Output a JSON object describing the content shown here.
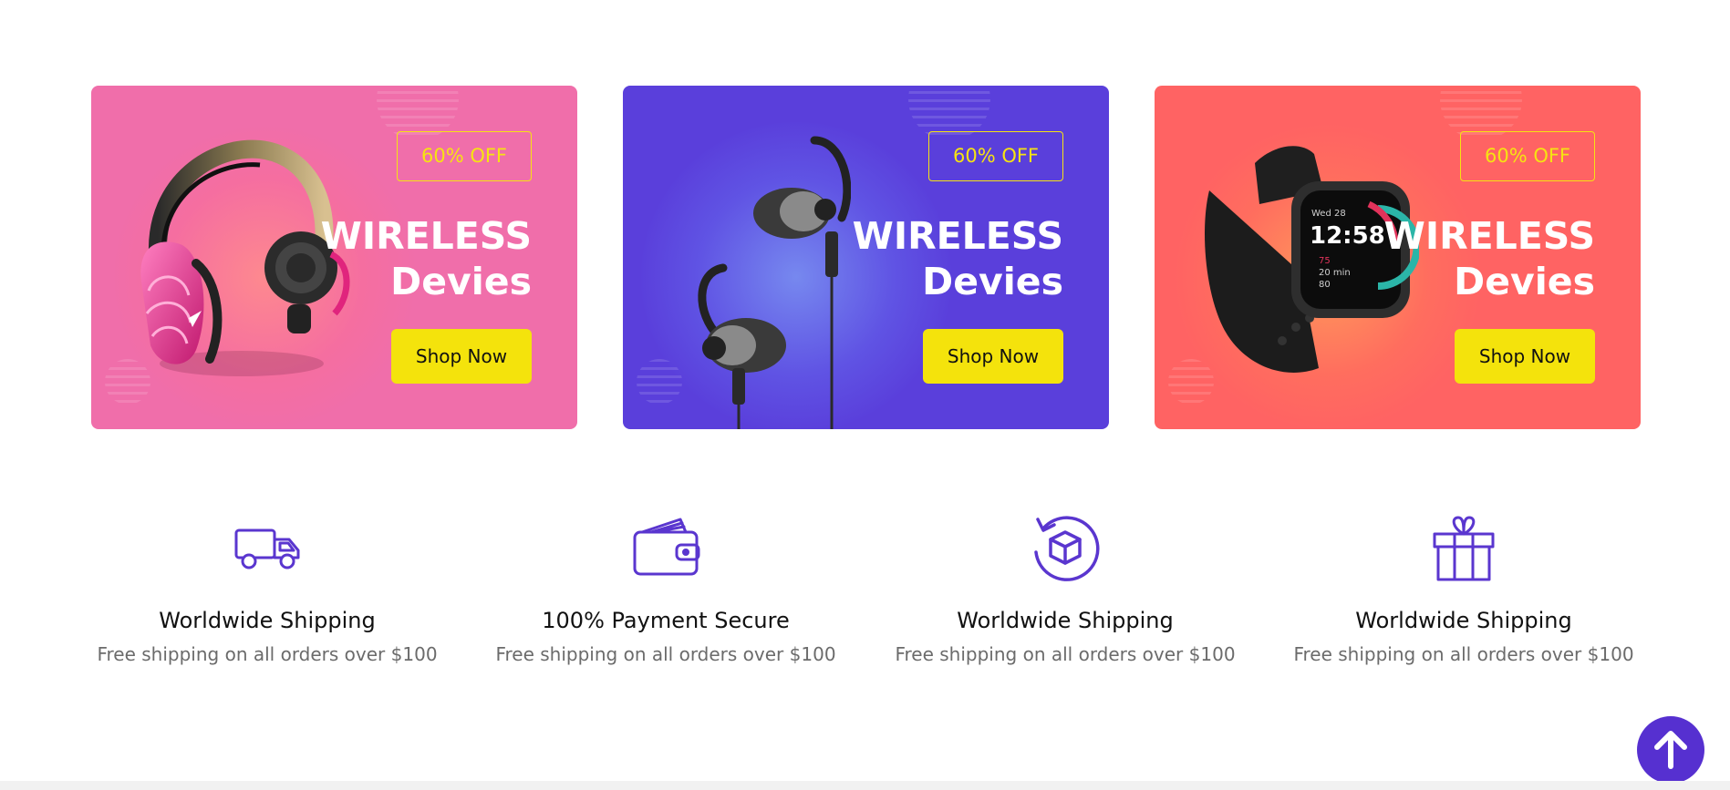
{
  "banners": [
    {
      "discount": "60% OFF",
      "title_line1": "WIRELESS",
      "title_line2": "Devies",
      "button": "Shop Now",
      "product": "headphones",
      "background": "#f06eaa"
    },
    {
      "discount": "60% OFF",
      "title_line1": "WIRELESS",
      "title_line2": "Devies",
      "button": "Shop Now",
      "product": "earphones",
      "background": "#5a3fdb"
    },
    {
      "discount": "60% OFF",
      "title_line1": "WIRELESS",
      "title_line2": "Devies",
      "button": "Shop Now",
      "product": "smartwatch",
      "background": "#ff6363"
    }
  ],
  "watch_screen": {
    "date": "Wed 28",
    "time": "12:58",
    "stat1": "75",
    "stat2": "20 min",
    "stat3": "80"
  },
  "features": [
    {
      "icon": "truck-icon",
      "title": "Worldwide Shipping",
      "text": "Free shipping on all orders over $100"
    },
    {
      "icon": "wallet-icon",
      "title": "100% Payment Secure",
      "text": "Free shipping on all orders over $100"
    },
    {
      "icon": "box-return-icon",
      "title": "Worldwide Shipping",
      "text": "Free shipping on all orders over $100"
    },
    {
      "icon": "gift-icon",
      "title": "Worldwide Shipping",
      "text": "Free shipping on all orders over $100"
    }
  ],
  "colors": {
    "accent": "#5630d0",
    "button": "#f4e30c",
    "discount_text": "#f6e312",
    "icon": "#5a36cf"
  },
  "scroll_top_icon": "arrow-up-icon"
}
